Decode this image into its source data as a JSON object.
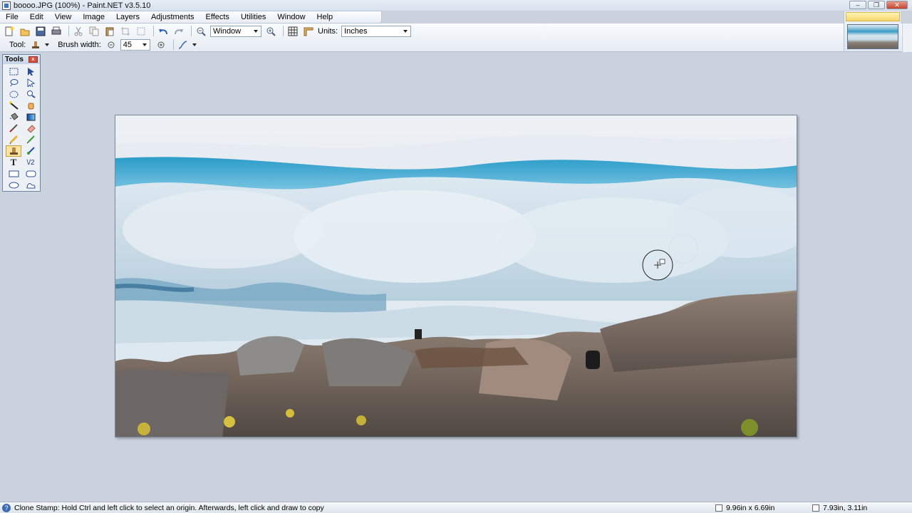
{
  "window": {
    "title": "boooo.JPG (100%) - Paint.NET v3.5.10",
    "min_label": "–",
    "max_label": "❐",
    "close_label": "✕"
  },
  "menu": [
    "File",
    "Edit",
    "View",
    "Image",
    "Layers",
    "Adjustments",
    "Effects",
    "Utilities",
    "Window",
    "Help"
  ],
  "toolbar": {
    "zoom_value": "Window",
    "units_label": "Units:",
    "units_value": "Inches",
    "tool_label": "Tool:",
    "brush_width_label": "Brush width:",
    "brush_width_value": "45"
  },
  "tools_panel": {
    "title": "Tools",
    "text_tool_glyph": "T",
    "line_tool_glyph": "\\/2"
  },
  "status": {
    "help_glyph": "?",
    "message": "Clone Stamp: Hold Ctrl and left click to select an origin. Afterwards, left click and draw to copy",
    "image_size": "9.96in x 6.69in",
    "cursor_pos": "7.93in, 3.11in"
  },
  "colors": {
    "workspace": "#c9d2dd",
    "accent": "#3a76c0",
    "active_tool": "#fbe3a0"
  },
  "icons": [
    "app-icon",
    "new-icon",
    "open-icon",
    "save-icon",
    "print-icon",
    "cut-icon",
    "copy-icon",
    "paste-icon",
    "crop-icon",
    "deselect-icon",
    "undo-icon",
    "redo-icon",
    "zoom-out-icon",
    "zoom-in-icon",
    "grid-icon",
    "ruler-icon",
    "clone-stamp-icon",
    "antialias-icon"
  ]
}
